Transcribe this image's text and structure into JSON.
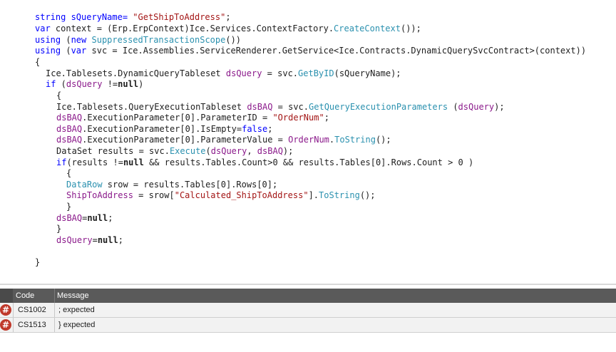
{
  "code": {
    "l1a": "string sQueryName= ",
    "l1b": "\"GetShipToAddress\"",
    "l1c": ";",
    "l2a": "var",
    "l2b": " context = (Erp.ErpContext)Ice.Services.ContextFactory.",
    "l2c": "CreateContext",
    "l2d": "());",
    "l3a": "using",
    "l3b": " (",
    "l3c": "new",
    "l3d": " ",
    "l3e": "SuppressedTransactionScope",
    "l3f": "())",
    "l4a": "using",
    "l4b": " (",
    "l4c": "var",
    "l4d": " svc = Ice.Assemblies.ServiceRenderer.GetService<Ice.Contracts.DynamicQuerySvcContract>(context))",
    "l5": "{",
    "l6a": "Ice.Tablesets.DynamicQueryTableset ",
    "l6b": "dsQuery",
    "l6c": " = svc.",
    "l6d": "GetByID",
    "l6e": "(sQueryName);",
    "l7a": "if",
    "l7b": " (",
    "l7c": "dsQuery",
    "l7d": " !=",
    "l7e": "null",
    "l7f": ")",
    "l8": "{",
    "l9a": "Ice.Tablesets.QueryExecutionTableset ",
    "l9b": "dsBAQ",
    "l9c": " = svc.",
    "l9d": "GetQueryExecutionParameters",
    "l9e": " (",
    "l9f": "dsQuery",
    "l9g": ");",
    "l10a": "dsBAQ",
    "l10b": ".ExecutionParameter[0].ParameterID = ",
    "l10c": "\"OrderNum\"",
    "l10d": ";",
    "l11a": "dsBAQ",
    "l11b": ".ExecutionParameter[0].IsEmpty=",
    "l11c": "false",
    "l11d": ";",
    "l12a": "dsBAQ",
    "l12b": ".ExecutionParameter[0].ParameterValue = ",
    "l12c": "OrderNum",
    "l12d": ".",
    "l12e": "ToString",
    "l12f": "();",
    "l13a": "DataSet results = svc.",
    "l13b": "Execute",
    "l13c": "(",
    "l13d": "dsQuery",
    "l13e": ", ",
    "l13f": "dsBAQ",
    "l13g": ");",
    "l14a": "if",
    "l14b": "(results !=",
    "l14c": "null",
    "l14d": " && results.Tables.Count>0 && results.Tables[0].Rows.Count > 0 )",
    "l15": "{",
    "l16a": "DataRow",
    "l16b": " srow = results.Tables[0].Rows[0];",
    "l17a": "ShipToAddress",
    "l17b": " = srow[",
    "l17c": "\"Calculated_ShipToAddress\"",
    "l17d": "].",
    "l17e": "ToString",
    "l17f": "();",
    "l18": "}",
    "l19a": "dsBAQ",
    "l19b": "=",
    "l19c": "null",
    "l19d": ";",
    "l20": "}",
    "l21a": "dsQuery",
    "l21b": "=",
    "l21c": "null",
    "l21d": ";",
    "l23": "}"
  },
  "errors": {
    "header_code": "Code",
    "header_message": "Message",
    "rows": [
      {
        "code": "CS1002",
        "message": "; expected"
      },
      {
        "code": "CS1513",
        "message": "} expected"
      }
    ],
    "icon_glyph": "#"
  },
  "colors": {
    "keyword": "#0000ff",
    "string": "#a31515",
    "identifier": "#8b1a8b",
    "method": "#2b91af",
    "error_icon": "#c0392b"
  }
}
